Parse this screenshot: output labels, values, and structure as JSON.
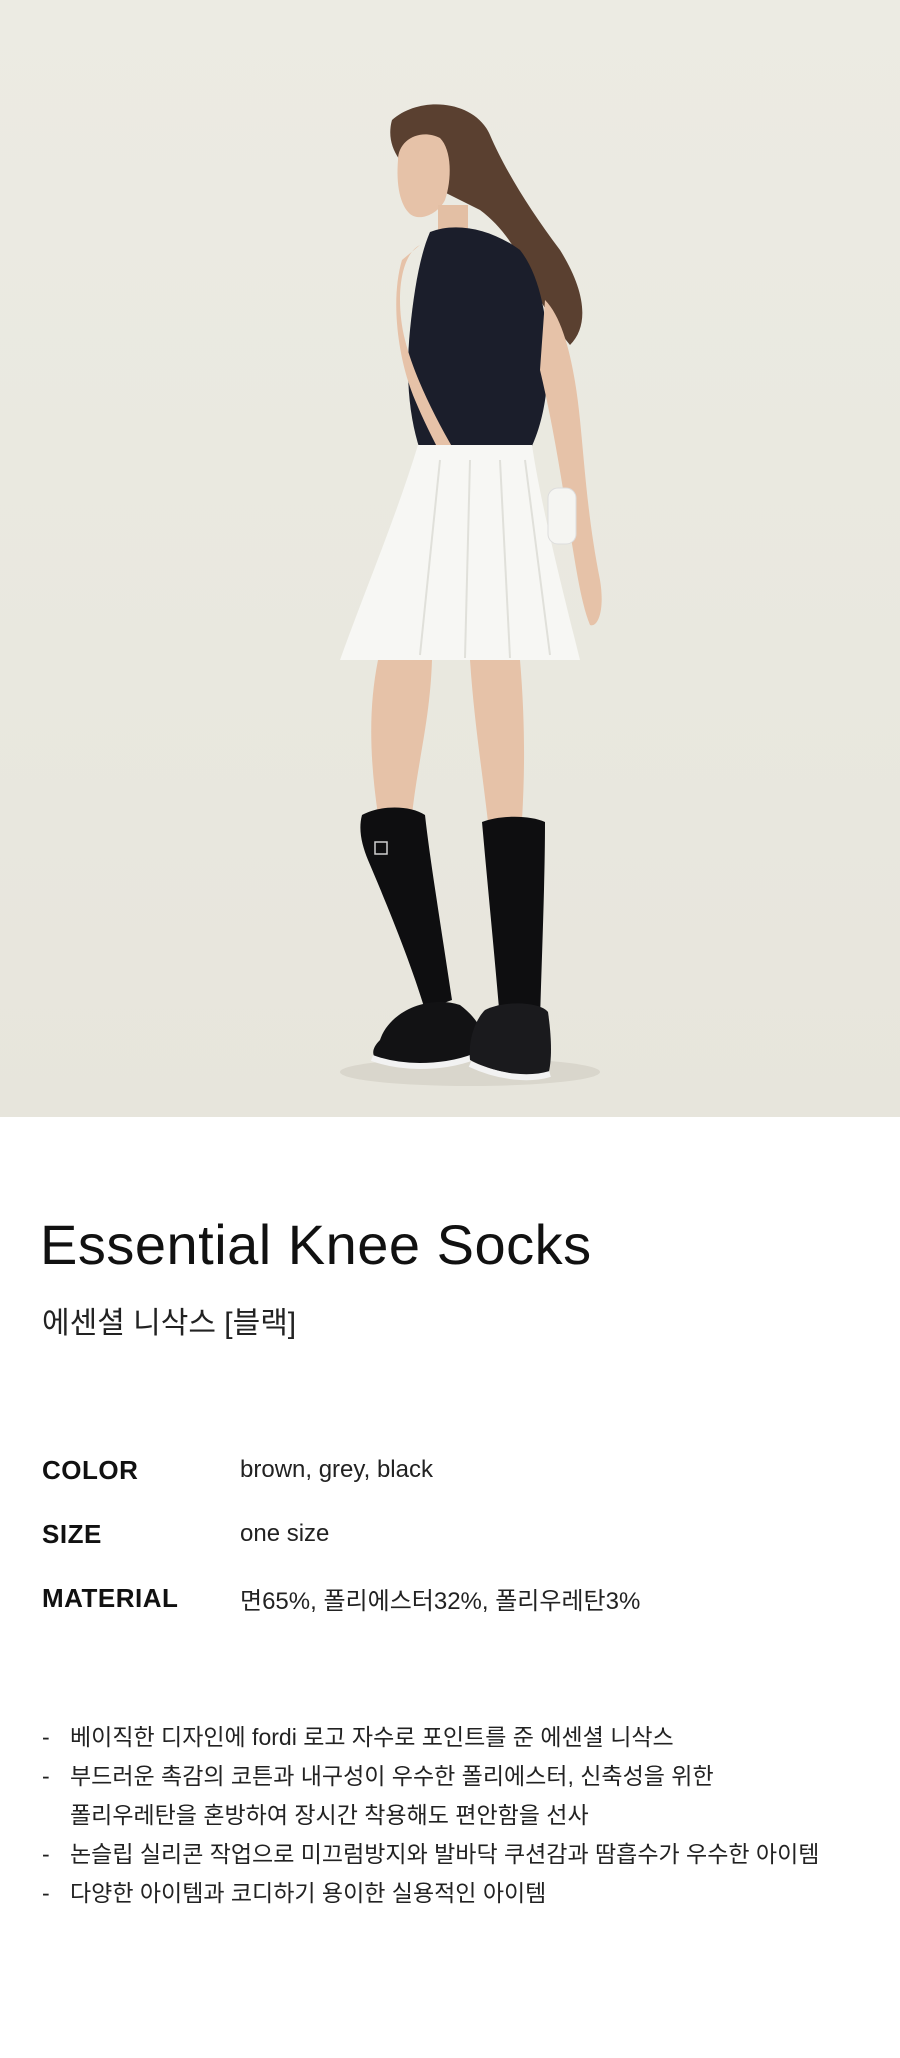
{
  "product": {
    "title": "Essential Knee Socks",
    "subtitle": "에센셜 니삭스 [블랙]"
  },
  "specs": [
    {
      "label": "COLOR",
      "value": "brown, grey, black"
    },
    {
      "label": "SIZE",
      "value": "one size"
    },
    {
      "label": "MATERIAL",
      "value": "면65%, 폴리에스터32%, 폴리우레탄3%"
    }
  ],
  "notes": [
    "베이직한 디자인에 fordi 로고 자수로 포인트를 준 에센셜 니삭스",
    "부드러운 촉감의 코튼과 내구성이 우수한 폴리에스터, 신축성을 위한\n폴리우레탄을 혼방하여 장시간 착용해도 편안함을 선사",
    "논슬립 실리콘 작업으로 미끄럼방지와 발바닥 쿠션감과 땀흡수가 우수한 아이템",
    "다양한 아이템과 코디하기 용이한 실용적인 아이템"
  ],
  "note_bullet": "-",
  "colors": {
    "background": "#ecebe3",
    "top": "#1b1e2b",
    "skirt": "#f7f7f4",
    "socks": "#0e0e10",
    "skin": "#e6c2a8",
    "hair": "#5a4030"
  }
}
